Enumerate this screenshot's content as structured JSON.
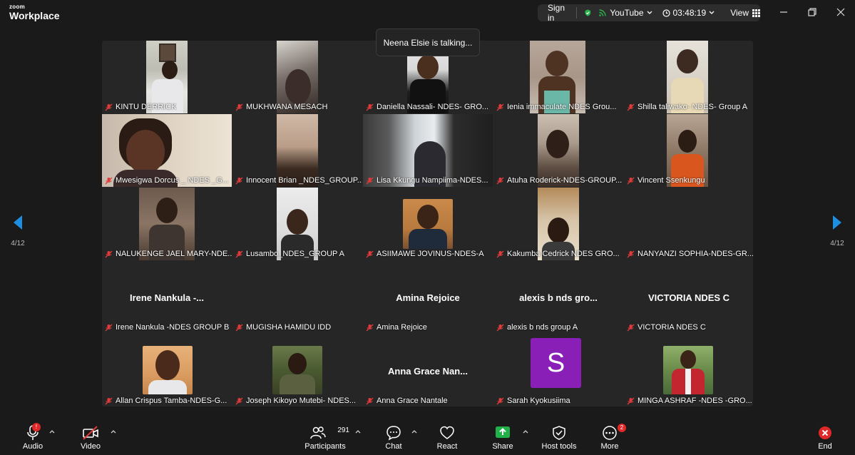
{
  "app": {
    "brand_top": "zoom",
    "brand_bottom": "Workplace"
  },
  "topbar": {
    "sign_in": "Sign in",
    "stream": "YouTube",
    "timer": "03:48:19",
    "view": "View"
  },
  "toast": "Neena Elsie is talking...",
  "pager": {
    "left": "4/12",
    "right": "4/12"
  },
  "tiles": [
    "KINTU DERRICK",
    "MUKHWANA MESACH",
    "Daniella Nassali- NDES- GRO...",
    "Ienia immaculate NDES Grou...",
    "Shilla taliwako- NDES- Group A",
    "Mwesigwa Dorcus _ NDES _G...",
    "Innocent Brian _NDES_GROUP...",
    "Lisa Kkungu Nampiima-NDES...",
    "Atuha Roderick-NDES-GROUP...",
    "Vincent Ssenkungu",
    "NALUKENGE JAEL MARY-NDE...",
    "Lusambo_NDES_GROUP A",
    "ASIIMAWE JOVINUS-NDES-A",
    "Kakumba Cedrick NDES GRO...",
    "NANYANZI SOPHIA-NDES-GR...",
    "Irene Nankula -NDES GROUP B",
    "MUGISHA HAMIDU IDD",
    "Amina Rejoice",
    "alexis b nds group A",
    "VICTORIA NDES C",
    "Allan Crispus Tamba-NDES-G...",
    "Joseph Kikoyo Mutebi- NDES...",
    "Anna Grace Nantale",
    "Sarah Kyokusiima",
    "MINGA ASHRAF -NDES -GRO..."
  ],
  "big_names": {
    "irene": "Irene Nankula -...",
    "amina": "Amina Rejoice",
    "alexis": "alexis b nds gro...",
    "victoria": "VICTORIA NDES C",
    "anna": "Anna Grace Nan..."
  },
  "avatar_letter": "S",
  "toolbar": {
    "audio": "Audio",
    "audio_badge": "!",
    "video": "Video",
    "participants": "Participants",
    "participants_count": "291",
    "chat": "Chat",
    "react": "React",
    "share": "Share",
    "host_tools": "Host tools",
    "more": "More",
    "more_badge": "2",
    "end": "End"
  }
}
